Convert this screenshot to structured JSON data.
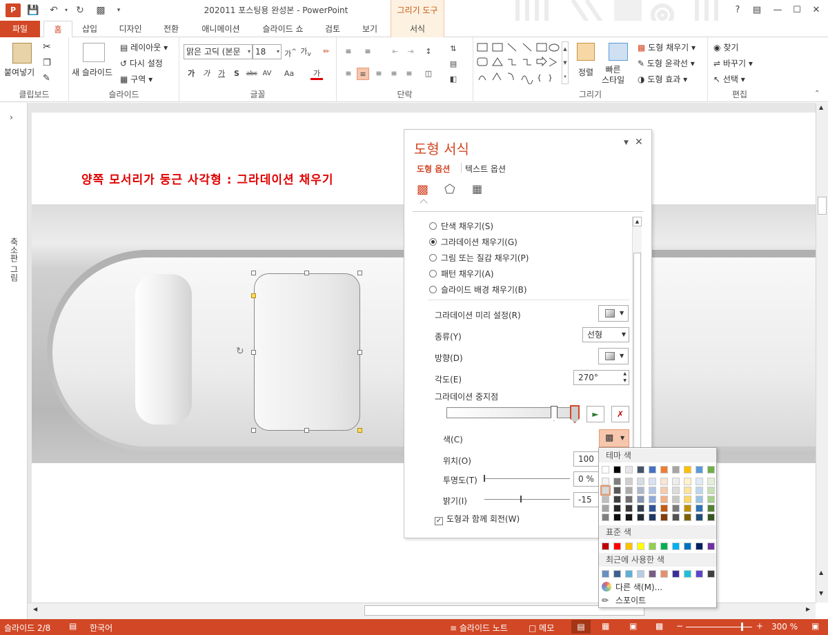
{
  "window": {
    "title": "202011 포스팅용 완성본 - PowerPoint",
    "context_tools": "그리기 도구",
    "help": "?",
    "app_badge": "P"
  },
  "tabs": [
    "파일",
    "홈",
    "삽입",
    "디자인",
    "전환",
    "애니메이션",
    "슬라이드 쇼",
    "검토",
    "보기",
    "서식"
  ],
  "ribbon": {
    "clipboard": {
      "paste": "붙여넣기",
      "group": "클립보드"
    },
    "slides": {
      "new_slide": "새 슬라이드",
      "layout": "레이아웃",
      "reset": "다시 설정",
      "section": "구역",
      "group": "슬라이드"
    },
    "font": {
      "name": "맑은 고딕 (본문",
      "size": "18",
      "group": "글꼴"
    },
    "paragraph": {
      "group": "단락"
    },
    "drawing": {
      "arrange": "정렬",
      "quick_styles": "빠른\n스타일",
      "shape_fill": "도형 채우기",
      "shape_outline": "도형 윤곽선",
      "shape_effects": "도형 효과",
      "group": "그리기"
    },
    "editing": {
      "find": "찾기",
      "replace": "바꾸기",
      "select": "선택",
      "group": "편집"
    }
  },
  "left_pane": {
    "label": "축소판 그림"
  },
  "slide": {
    "heading": "양쪽 모서리가 둥근 사각형 : 그라데이션 채우기"
  },
  "format_pane": {
    "title": "도형 서식",
    "tab_shape": "도형 옵션",
    "tab_text": "텍스트 옵션",
    "fill_options": [
      {
        "label": "단색 채우기(S)",
        "selected": false
      },
      {
        "label": "그라데이션 채우기(G)",
        "selected": true
      },
      {
        "label": "그림 또는 질감 채우기(P)",
        "selected": false
      },
      {
        "label": "패턴 채우기(A)",
        "selected": false
      },
      {
        "label": "슬라이드 배경 채우기(B)",
        "selected": false
      }
    ],
    "preset_label": "그라데이션 미리 설정(R)",
    "type_label": "종류(Y)",
    "type_value": "선형",
    "direction_label": "방향(D)",
    "angle_label": "각도(E)",
    "angle_value": "270°",
    "stops_label": "그라데이션 중지점",
    "color_label": "색(C)",
    "position_label": "위치(O)",
    "position_value": "100 %",
    "transparency_label": "투명도(T)",
    "transparency_value": "0 %",
    "brightness_label": "밝기(I)",
    "brightness_value": "-15 %",
    "rotate_with_shape": "도형과 함께 회전(W)",
    "rotate_checked": true
  },
  "color_picker": {
    "theme_header": "테마 색",
    "standard_header": "표준 색",
    "recent_header": "최근에 사용한 색",
    "more_colors": "다른 색(M)...",
    "eyedropper": "스포이트",
    "theme_top": [
      "#ffffff",
      "#000000",
      "#e7e6e6",
      "#44546a",
      "#4472c4",
      "#ed7d31",
      "#a5a5a5",
      "#ffc000",
      "#5b9bd5",
      "#70ad47"
    ],
    "theme_shades": [
      [
        "#f2f2f2",
        "#7f7f7f",
        "#d0cece",
        "#d6dce4",
        "#d9e2f3",
        "#fbe5d5",
        "#ededed",
        "#fff2cc",
        "#deebf6",
        "#e2efd9"
      ],
      [
        "#d8d8d8",
        "#595959",
        "#aeabab",
        "#adb9ca",
        "#b4c6e7",
        "#f7cbac",
        "#dbdbdb",
        "#fee599",
        "#bdd7ee",
        "#c5e0b3"
      ],
      [
        "#bfbfbf",
        "#3f3f3f",
        "#757070",
        "#8496b0",
        "#8eaadb",
        "#f4b183",
        "#c9c9c9",
        "#ffd965",
        "#9cc3e5",
        "#a8d08d"
      ],
      [
        "#a5a5a5",
        "#262626",
        "#3a3838",
        "#323f4f",
        "#2f5496",
        "#c55a11",
        "#7b7b7b",
        "#bf9000",
        "#2e75b5",
        "#538135"
      ],
      [
        "#7f7f7f",
        "#0c0c0c",
        "#171616",
        "#222a35",
        "#1f3864",
        "#833c0b",
        "#525252",
        "#7f6000",
        "#1e4e79",
        "#375623"
      ]
    ],
    "standard": [
      "#c00000",
      "#ff0000",
      "#ffc000",
      "#ffff00",
      "#92d050",
      "#00b050",
      "#00b0f0",
      "#0070c0",
      "#002060",
      "#7030a0"
    ],
    "recent": [
      "#6a8fc0",
      "#3c6190",
      "#5fb0d8",
      "#b8cce4",
      "#7a5c86",
      "#e4906c",
      "#3b2e9c",
      "#1ec0d8",
      "#5c46c8",
      "#404040"
    ]
  },
  "statusbar": {
    "slide": "슬라이드 2/8",
    "language": "한국어",
    "notes": "슬라이드 노트",
    "comments": "메모",
    "zoom": "300 %"
  },
  "colors": {
    "accent": "#d24726",
    "heading": "#e00000",
    "selected_bg": "#f6c6ad"
  }
}
